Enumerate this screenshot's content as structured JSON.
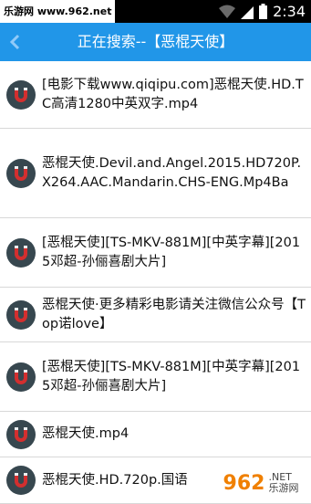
{
  "status_bar": {
    "watermark": "乐游网 www.962.net",
    "time": "2:34"
  },
  "header": {
    "title": "正在搜索--【恶棍天使】"
  },
  "results": [
    {
      "title": "[电影下载www.qiqipu.com]恶棍天使.HD.TC高清1280中英双字.mp4"
    },
    {
      "title": "恶棍天使.Devil.and.Angel.2015.HD720P.X264.AAC.Mandarin.CHS-ENG.Mp4Ba"
    },
    {
      "title": "[恶棍天使][TS-MKV-881M][中英字幕][2015邓超-孙俪喜剧大片]"
    },
    {
      "title": "恶棍天使·更多精彩电影请关注微信公众号【Top诺love】"
    },
    {
      "title": "[恶棍天使][TS-MKV-881M][中英字幕][2015邓超-孙俪喜剧大片]"
    },
    {
      "title": "恶棍天使.mp4"
    },
    {
      "title": "恶棍天使.HD.720p.国语"
    }
  ],
  "watermark_logo": {
    "number": "962",
    "suffix": ".NET",
    "text": "乐游网"
  },
  "colors": {
    "title_bar": "#2196e8",
    "magnet_red": "#d32f2f",
    "magnet_dark": "#37474f"
  }
}
